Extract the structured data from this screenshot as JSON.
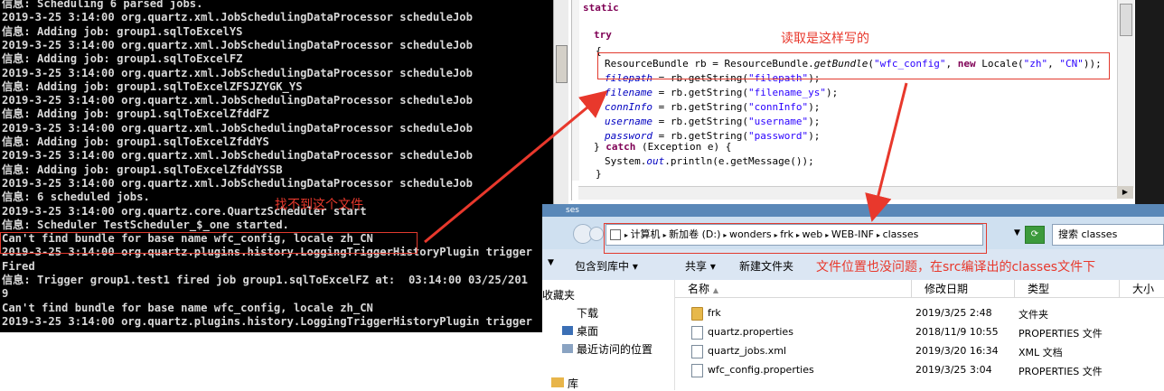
{
  "console": {
    "lines": [
      "信息: Scheduling 6 parsed jobs.",
      "2019-3-25 3:14:00 org.quartz.xml.JobSchedulingDataProcessor scheduleJob",
      "信息: Adding job: group1.sqlToExcelYS",
      "2019-3-25 3:14:00 org.quartz.xml.JobSchedulingDataProcessor scheduleJob",
      "信息: Adding job: group1.sqlToExcelFZ",
      "2019-3-25 3:14:00 org.quartz.xml.JobSchedulingDataProcessor scheduleJob",
      "信息: Adding job: group1.sqlToExcelZFSJZYGK_YS",
      "2019-3-25 3:14:00 org.quartz.xml.JobSchedulingDataProcessor scheduleJob",
      "信息: Adding job: group1.sqlToExcelZfddFZ",
      "2019-3-25 3:14:00 org.quartz.xml.JobSchedulingDataProcessor scheduleJob",
      "信息: Adding job: group1.sqlToExcelZfddYS",
      "2019-3-25 3:14:00 org.quartz.xml.JobSchedulingDataProcessor scheduleJob",
      "信息: Adding job: group1.sqlToExcelZfddYSSB",
      "2019-3-25 3:14:00 org.quartz.xml.JobSchedulingDataProcessor scheduleJob",
      "信息: 6 scheduled jobs.",
      "2019-3-25 3:14:00 org.quartz.core.QuartzScheduler start",
      "信息: Scheduler TestScheduler_$_one started.",
      "Can't find bundle for base name wfc_config, locale zh_CN",
      "2019-3-25 3:14:00 org.quartz.plugins.history.LoggingTriggerHistoryPlugin trigger",
      "Fired",
      "信息: Trigger group1.test1 fired job group1.sqlToExcelFZ at:  03:14:00 03/25/201",
      "9",
      "Can't find bundle for base name wfc_config, locale zh_CN",
      "2019-3-25 3:14:00 org.quartz.plugins.history.LoggingTriggerHistoryPlugin trigger"
    ]
  },
  "editor": {
    "static_kw": "static",
    "try_kw": "try",
    "brace_open": "{",
    "line1": {
      "pre": "ResourceBundle rb = ResourceBundle.",
      "method": "getBundle",
      "arg1": "\"wfc_config\"",
      "mid": ", ",
      "new_kw": "new",
      "post": " Locale(",
      "arg2": "\"zh\"",
      "sep": ", ",
      "arg3": "\"CN\"",
      "end": "));"
    },
    "assigns": [
      {
        "field": "filepath",
        "key": "\"filepath\""
      },
      {
        "field": "filename",
        "key": "\"filename_ys\""
      },
      {
        "field": "connInfo",
        "key": "\"connInfo\""
      },
      {
        "field": "username",
        "key": "\"username\""
      },
      {
        "field": "password",
        "key": "\"password\""
      }
    ],
    "assign_mid": " = rb.getString(",
    "assign_end": ");",
    "catch_pre": "} ",
    "catch_kw": "catch",
    "catch_post": " (Exception e) {",
    "println_pre": "System.",
    "println_out": "out",
    "println_post": ".println(e.getMessage());",
    "brace_close": "}"
  },
  "explorer": {
    "title_fragment": "ses",
    "path": [
      "计算机",
      "新加卷 (D:)",
      "wonders",
      "frk",
      "web",
      "WEB-INF",
      "classes"
    ],
    "search_placeholder": "搜索 classes",
    "toolbar": [
      "包含到库中 ▾",
      "共享 ▾",
      "新建文件夹"
    ],
    "nav": [
      "收藏夹",
      "下载",
      "桌面",
      "最近访问的位置",
      "库"
    ],
    "columns": [
      "名称",
      "修改日期",
      "类型",
      "大小"
    ],
    "files": [
      {
        "name": "frk",
        "date": "2019/3/25 2:48",
        "type": "文件夹",
        "icon": "folder"
      },
      {
        "name": "quartz.properties",
        "date": "2018/11/9 10:55",
        "type": "PROPERTIES 文件",
        "icon": "file"
      },
      {
        "name": "quartz_jobs.xml",
        "date": "2019/3/20 16:34",
        "type": "XML 文档",
        "icon": "file"
      },
      {
        "name": "wfc_config.properties",
        "date": "2019/3/25 3:04",
        "type": "PROPERTIES 文件",
        "icon": "file"
      }
    ]
  },
  "annotations": {
    "not_found": "找不到这个文件",
    "read_like": "读取是这样写的",
    "location_ok": "文件位置也没问题，在src编译出的classes文件下"
  },
  "colors": {
    "annotation": "#e8382c",
    "keyword": "#7f0055",
    "string": "#2a00ff"
  }
}
